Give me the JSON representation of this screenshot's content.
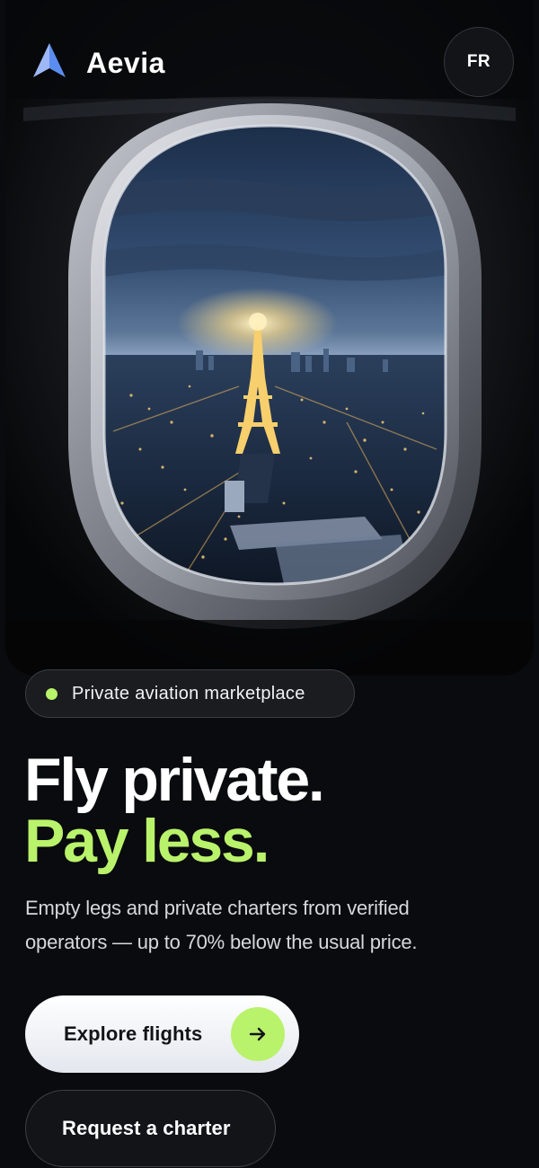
{
  "header": {
    "brand_name": "Aevia",
    "logo_icon": "a-wing-logo-icon",
    "language_button": "FR"
  },
  "hero": {
    "image": "airplane-window-paris-eiffel-tower-night"
  },
  "badge": {
    "text": "Private aviation marketplace",
    "dot_color": "#b9f26b"
  },
  "headline": {
    "line1": "Fly private.",
    "line2": "Pay less."
  },
  "description": "Empty legs and private charters from verified operators — up to 70% below the usual price.",
  "actions": {
    "primary_label": "Explore flights",
    "primary_icon": "arrow-right-icon",
    "secondary_label": "Request a charter"
  },
  "colors": {
    "accent": "#b9f26b",
    "background": "#090b0e",
    "logo_blue": "#5b8cf0"
  }
}
